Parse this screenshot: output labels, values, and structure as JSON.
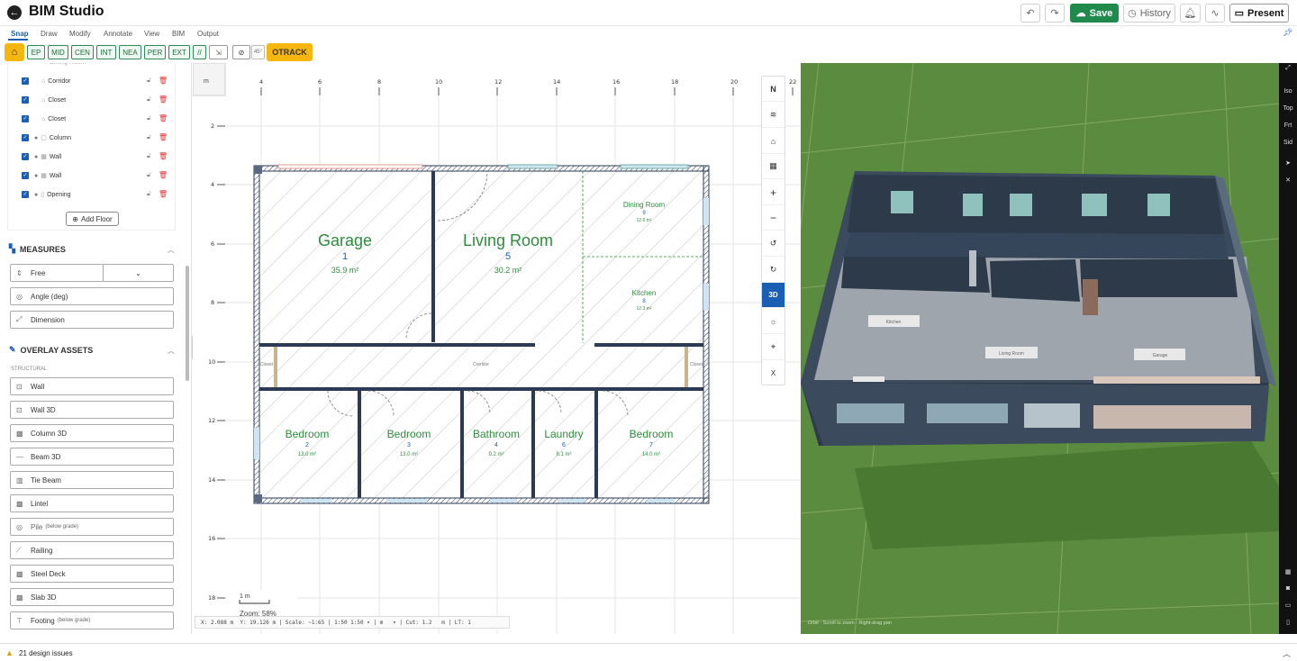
{
  "header": {
    "title": "BIM Studio",
    "save_label": "Save",
    "history_label": "History",
    "present_label": "Present",
    "back_icon": "arrow-left-icon"
  },
  "menu": {
    "items": [
      "Snap",
      "Draw",
      "Modify",
      "Annotate",
      "View",
      "BIM",
      "Output"
    ]
  },
  "snap": {
    "buttons": [
      "EP",
      "MID",
      "CEN",
      "INT",
      "NEA",
      "PER",
      "EXT",
      "//"
    ],
    "angle": "45°",
    "otrack": "OTRACK"
  },
  "layers": [
    {
      "name": "Corridor"
    },
    {
      "name": "Closet"
    },
    {
      "name": "Closet"
    },
    {
      "name": "Column"
    },
    {
      "name": "Wall"
    },
    {
      "name": "Wall"
    },
    {
      "name": "Opening"
    }
  ],
  "add_floor": "Add Floor",
  "measures": {
    "title": "MEASURES",
    "mode": "Free",
    "angle": "Angle (deg)",
    "dimension": "Dimension"
  },
  "overlay": {
    "title": "OVERLAY ASSETS",
    "subtitle": "STRUCTURAL",
    "items": [
      {
        "label": "Wall",
        "note": ""
      },
      {
        "label": "Wall 3D",
        "note": ""
      },
      {
        "label": "Column 3D",
        "note": ""
      },
      {
        "label": "Beam 3D",
        "note": ""
      },
      {
        "label": "Tie Beam",
        "note": ""
      },
      {
        "label": "Lintel",
        "note": ""
      },
      {
        "label": "Pile",
        "note": "(below grade)"
      },
      {
        "label": "Railing",
        "note": ""
      },
      {
        "label": "Steel Deck",
        "note": ""
      },
      {
        "label": "Slab 3D",
        "note": ""
      },
      {
        "label": "Footing",
        "note": "(below grade)"
      }
    ]
  },
  "plan": {
    "unit": "m",
    "x_ticks": [
      "4",
      "6",
      "8",
      "10",
      "12",
      "14",
      "16",
      "18",
      "20",
      "22"
    ],
    "y_ticks": [
      "2",
      "4",
      "6",
      "8",
      "10",
      "12",
      "14",
      "16",
      "18"
    ],
    "rooms": [
      {
        "name": "Garage",
        "num": "1",
        "area": "35.9 m²"
      },
      {
        "name": "Living Room",
        "num": "5",
        "area": "30.2 m²"
      },
      {
        "name": "Dining Room",
        "num": "9",
        "area": "12.6 m²"
      },
      {
        "name": "Kitchen",
        "num": "8",
        "area": "12.3 m²"
      },
      {
        "name": "Corridor",
        "num": "",
        "area": ""
      },
      {
        "name": "Closet",
        "num": "",
        "area": ""
      },
      {
        "name": "Closet",
        "num": "",
        "area": ""
      },
      {
        "name": "Bedroom",
        "num": "2",
        "area": "13.0 m²"
      },
      {
        "name": "Bedroom",
        "num": "3",
        "area": "13.0 m²"
      },
      {
        "name": "Bathroom",
        "num": "4",
        "area": "9.2 m²"
      },
      {
        "name": "Laundry",
        "num": "6",
        "area": "8.1 m²"
      },
      {
        "name": "Bedroom",
        "num": "7",
        "area": "14.0 m²"
      }
    ],
    "scale_label": "1 m",
    "zoom": "Zoom: 58%",
    "status": "X: 2.088 m  Y: 19.126 m | Scale: ~1:65 | 1:50 1:50 ▾ | m   ▾ | Cut: 1.2   m | LT: 1"
  },
  "viewtools": [
    "N",
    "layers-icon",
    "home-icon",
    "grid-icon",
    "+",
    "−",
    "rotate-left-icon",
    "rotate-right-icon",
    "3D",
    "sun-icon",
    "pin-icon",
    "X"
  ],
  "view3d": {
    "labels": [
      "Kitchen",
      "Living Room",
      "Garage"
    ],
    "hint": "Orbit  ·  Scroll to zoom  ·  Right-drag pan"
  },
  "right_strip": [
    "Iso",
    "Top",
    "Frt",
    "Sid"
  ],
  "footer": {
    "issues": "21 design issues"
  }
}
